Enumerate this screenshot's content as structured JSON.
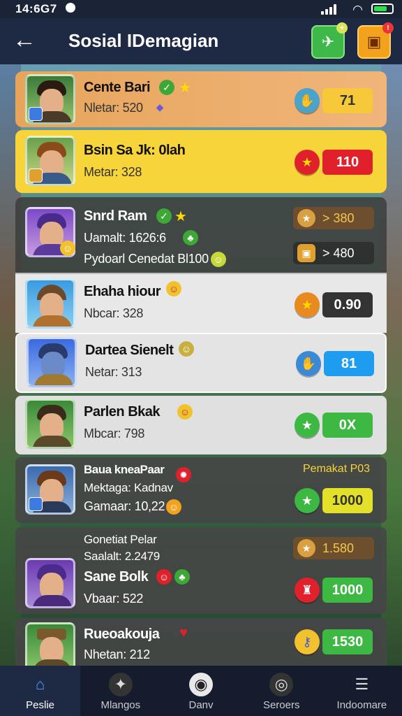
{
  "status": {
    "time": "14:6G7"
  },
  "header": {
    "title": "Sosial IDemagian"
  },
  "rows": [
    {
      "name": "Cente Bari",
      "meta": "Nletar: 520",
      "score": "71"
    },
    {
      "name": "Bsin Sa Jk: 0lah",
      "meta": "Metar: 328",
      "score": "110"
    },
    {
      "name": "Snrd Ram",
      "meta": "Uamalt: 1626:6",
      "meta2": "Pydoarl Cenedat Bl100",
      "pill1": "> 380",
      "pill2": "> 480"
    },
    {
      "name": "Ehaha hiour",
      "meta": "Nbcar: 328",
      "score": "0.90"
    },
    {
      "name": "Dartea Sienelt",
      "meta": "Netar: 313",
      "score": "81"
    },
    {
      "name": "Parlen Bkak",
      "meta": "Mbcar: 798",
      "score": "0X"
    },
    {
      "name": "Baua kneaPaar",
      "meta": "Mektaga: Kadnav",
      "meta2": "Gamaar: 10,22",
      "label": "Pemakat P03",
      "score": "1000"
    },
    {
      "name": "Sane Bolk",
      "meta_top": "Gonetiat Pelar",
      "meta_top2": "Saalalt: 2.2479",
      "meta": "Vbaar: 522",
      "pill1": "1.580",
      "score": "1000"
    },
    {
      "name": "Rueoakouja",
      "meta": "Nhetan: 212",
      "score": "1530"
    }
  ],
  "nav": [
    {
      "label": "Peslie",
      "icon": "home-icon"
    },
    {
      "label": "Mlangos",
      "icon": "gamepad-icon"
    },
    {
      "label": "Danv",
      "icon": "chat-icon"
    },
    {
      "label": "Seroers",
      "icon": "globe-icon"
    },
    {
      "label": "Indoomare",
      "icon": "menu-icon"
    }
  ],
  "colors": {
    "accent_yellow": "#f7d43a",
    "accent_orange": "#e89a4a",
    "header": "#1e2a44",
    "green": "#3db843",
    "red": "#e0202a",
    "blue": "#1e9df0"
  }
}
